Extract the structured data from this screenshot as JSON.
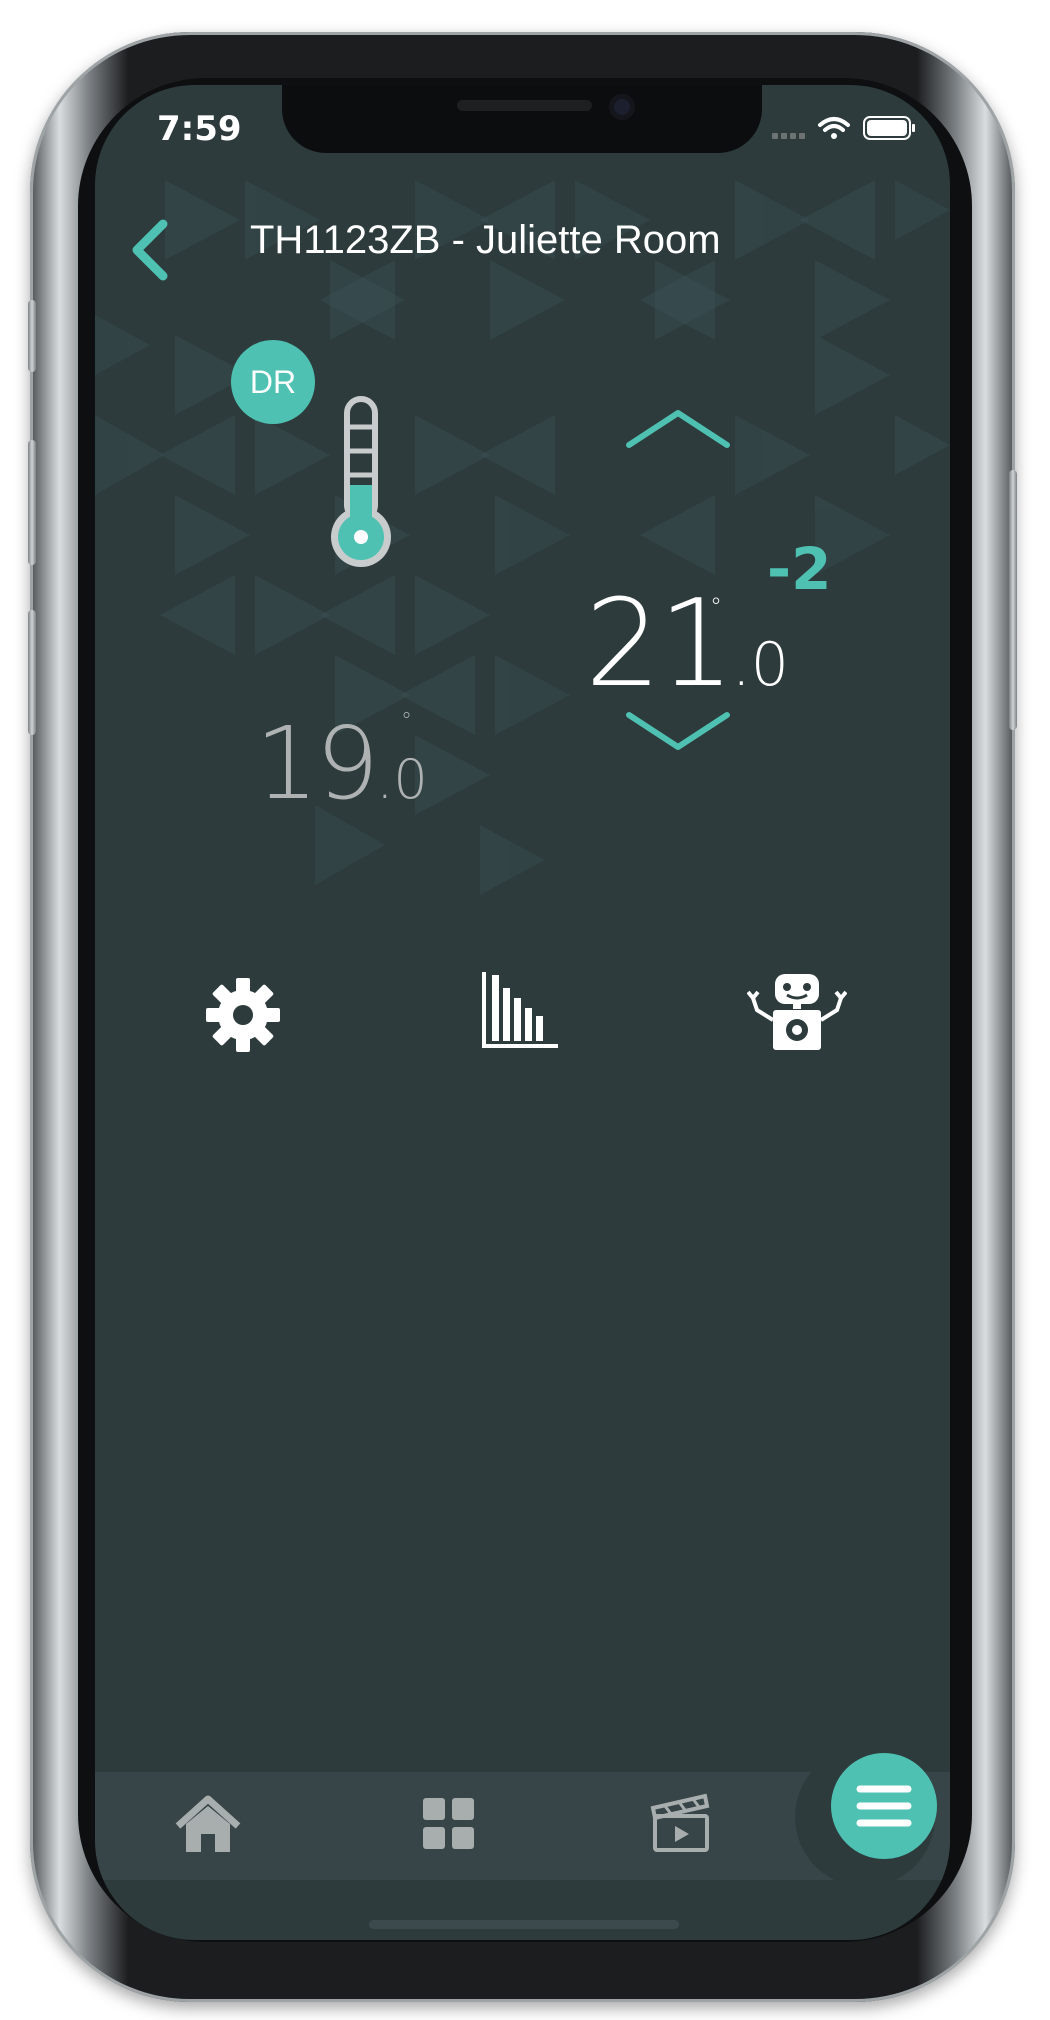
{
  "status_bar": {
    "time": "7:59",
    "signal_icon": "signal-dots-icon",
    "wifi_icon": "wifi-icon",
    "battery_icon": "battery-icon"
  },
  "header": {
    "back_icon": "chevron-left-icon",
    "title": "TH1123ZB - Juliette Room"
  },
  "thermostat": {
    "mode_badge": "DR",
    "current_temp": {
      "integer": "19",
      "decimal": ".0",
      "degree": "°"
    },
    "setpoint": {
      "integer": "21",
      "decimal": ".0",
      "degree": "°"
    },
    "offset": "-2",
    "increase_icon": "chevron-up-icon",
    "decrease_icon": "chevron-down-icon"
  },
  "actions": [
    {
      "name": "settings",
      "icon": "gear-icon"
    },
    {
      "name": "statistics",
      "icon": "bar-chart-icon"
    },
    {
      "name": "automation",
      "icon": "robot-icon"
    }
  ],
  "bottom_nav": [
    {
      "name": "home",
      "icon": "home-icon"
    },
    {
      "name": "dashboard",
      "icon": "grid-icon"
    },
    {
      "name": "scenes",
      "icon": "clapperboard-icon"
    }
  ],
  "fab": {
    "icon": "menu-icon"
  },
  "colors": {
    "accent": "#4ec1b2",
    "background": "#2d3b3c",
    "nav_bar": "#374548",
    "muted_text": "#aeb2b2",
    "icon_gray": "#a8adad"
  }
}
